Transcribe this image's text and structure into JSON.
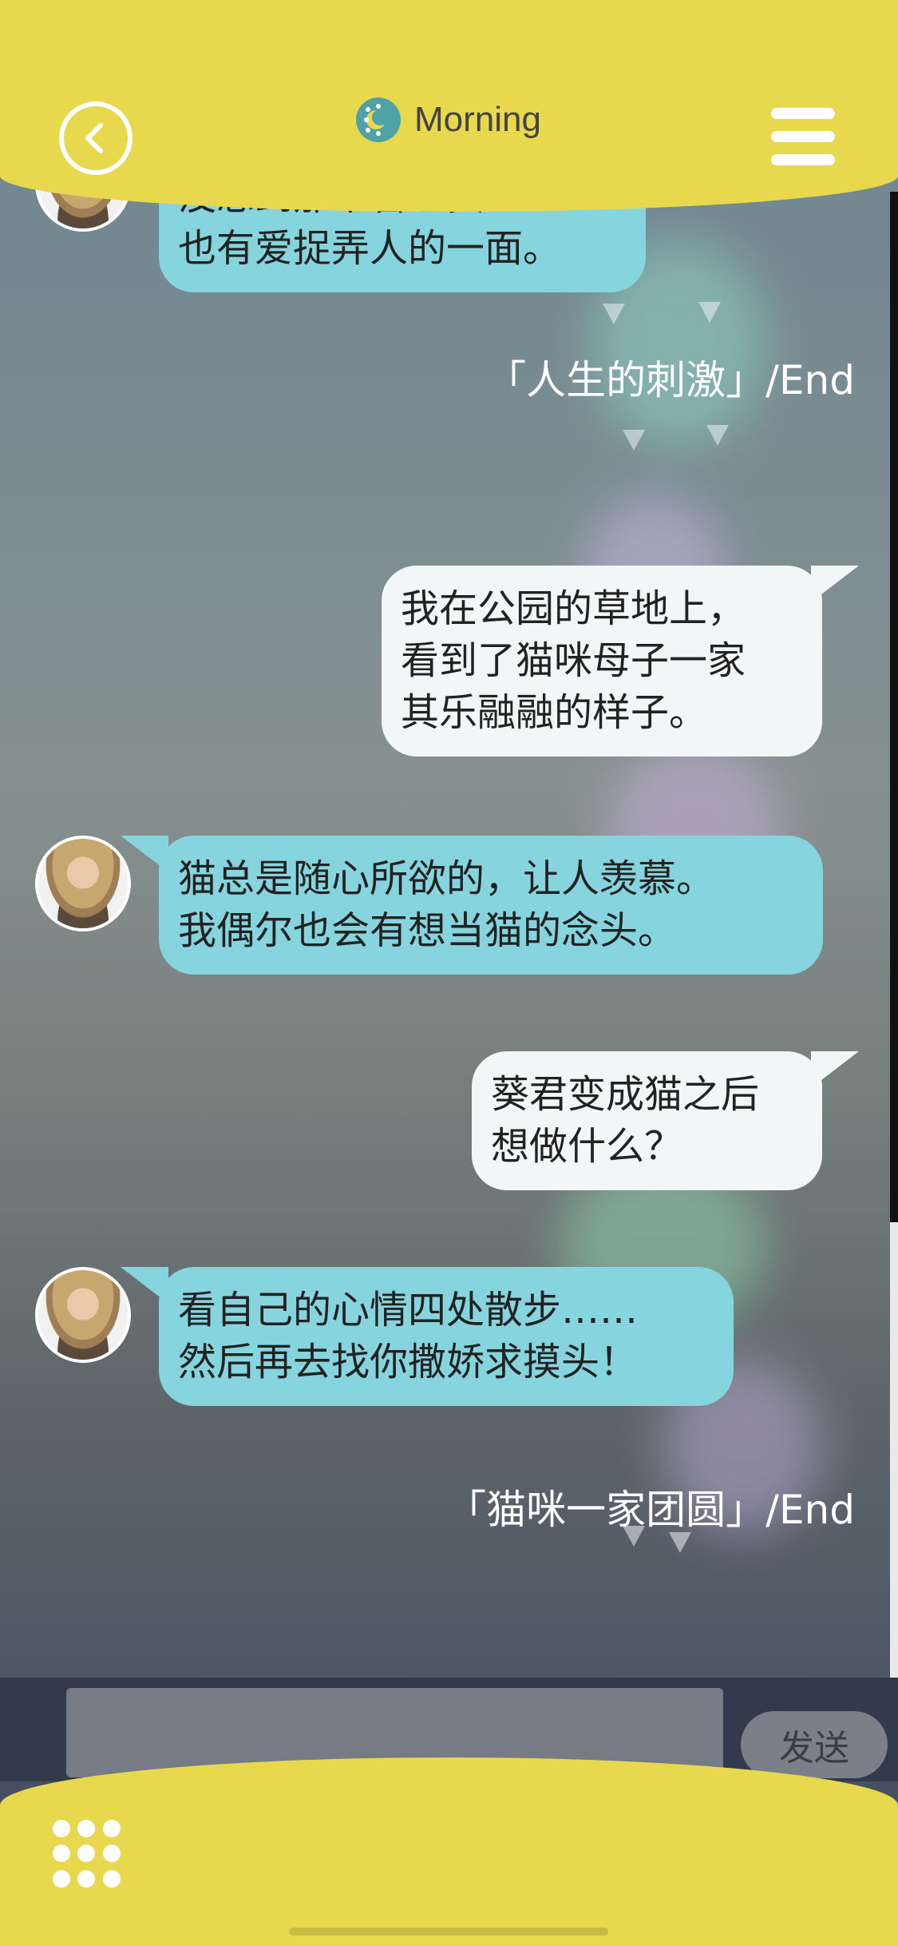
{
  "header": {
    "title": "Morning",
    "back_icon": "chevron-left-icon",
    "mode_icon": "sun-moon-icon",
    "menu_icon": "hamburger-menu-icon"
  },
  "colors": {
    "accent_yellow": "#e8d84e",
    "bubble_partner": "#86d5de",
    "bubble_self": "#f3f6f6",
    "input_bar": "#333a4b"
  },
  "chat": {
    "messages": [
      {
        "from": "partner",
        "lines": [
          "没想到那个管理员",
          "也有爱捉弄人的一面。"
        ]
      },
      {
        "type": "end",
        "text": "「人生的刺激」/End"
      },
      {
        "from": "self",
        "lines": [
          "我在公园的草地上，",
          "看到了猫咪母子一家",
          "其乐融融的样子。"
        ]
      },
      {
        "from": "partner",
        "lines": [
          "猫总是随心所欲的，让人羡慕。",
          "我偶尔也会有想当猫的念头。"
        ]
      },
      {
        "from": "self",
        "lines": [
          "葵君变成猫之后",
          "想做什么？"
        ]
      },
      {
        "from": "partner",
        "lines": [
          "看自己的心情四处散步……",
          "然后再去找你撒娇求摸头！"
        ]
      },
      {
        "type": "end",
        "text": "「猫咪一家团圆」/End"
      }
    ]
  },
  "input": {
    "placeholder": "",
    "send_label": "发送"
  },
  "footer": {
    "grid_icon": "grid-dots-icon"
  }
}
